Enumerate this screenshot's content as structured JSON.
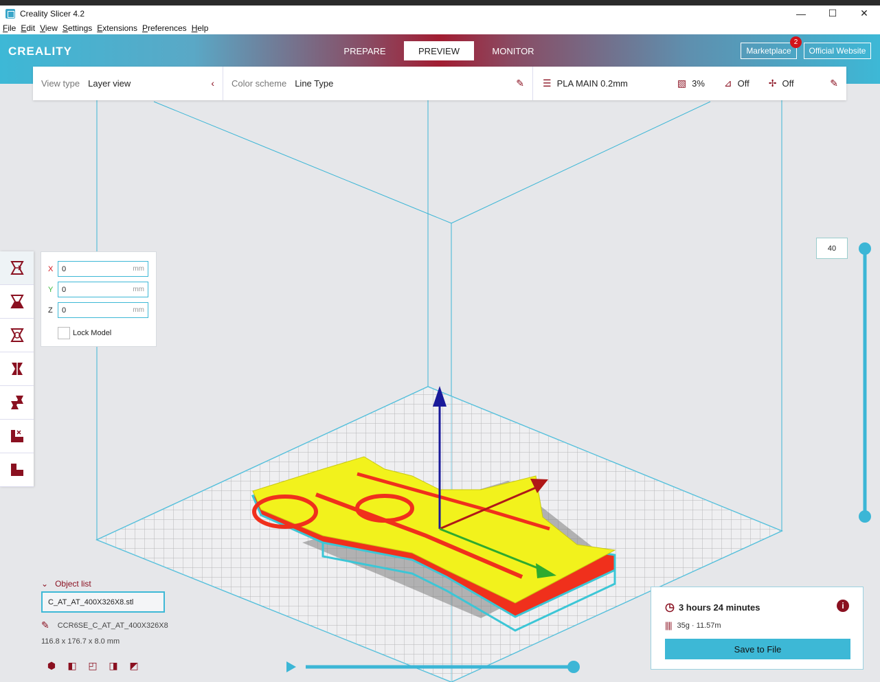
{
  "window": {
    "title": "Creality Slicer 4.2",
    "controls": {
      "minimize": "—",
      "maximize": "☐",
      "close": "✕"
    }
  },
  "menubar": {
    "items": [
      {
        "ul": "F",
        "rest": "ile"
      },
      {
        "ul": "E",
        "rest": "dit"
      },
      {
        "ul": "V",
        "rest": "iew"
      },
      {
        "ul": "S",
        "rest": "ettings"
      },
      {
        "ul": "E",
        "rest": "xtensions"
      },
      {
        "ul": "P",
        "rest": "references"
      },
      {
        "ul": "H",
        "rest": "elp"
      }
    ]
  },
  "header": {
    "logo": "CREALITY",
    "tabs": [
      "PREPARE",
      "PREVIEW",
      "MONITOR"
    ],
    "active_tab": "PREVIEW",
    "marketplace_label": "Marketplace",
    "marketplace_badge": "2",
    "website_label": "Official Website"
  },
  "toppanel": {
    "view_type_label": "View type",
    "view_type_value": "Layer view",
    "color_scheme_label": "Color scheme",
    "color_scheme_value": "Line Type",
    "profile": "PLA MAIN 0.2mm",
    "infill": "3%",
    "support": "Off",
    "adhesion": "Off"
  },
  "move_panel": {
    "x_label": "X",
    "x_value": "0",
    "y_label": "Y",
    "y_value": "0",
    "z_label": "Z",
    "z_value": "0",
    "unit": "mm",
    "lock_label": "Lock Model",
    "colors": {
      "x": "#d2131a",
      "y": "#3bb83b",
      "z": "#222222"
    }
  },
  "layer_slider": {
    "value": "40"
  },
  "object_list": {
    "header": "Object list",
    "file": "C_AT_AT_400X326X8.stl",
    "name": "CCR6SE_C_AT_AT_400X326X8",
    "dims": "116.8 x 176.7 x 8.0 mm"
  },
  "estimate": {
    "time": "3 hours 24 minutes",
    "material": "35g · 11.57m",
    "save_label": "Save to File"
  },
  "colors": {
    "accent": "#3db8d6",
    "brand_red": "#8a1020",
    "model_top": "#f2f21c",
    "model_side": "#f0301c",
    "outline": "#3cc6d6"
  }
}
